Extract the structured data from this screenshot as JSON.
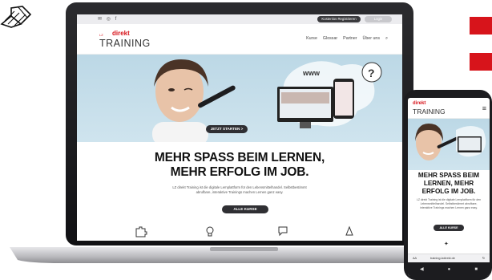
{
  "laptop_site": {
    "social_icons": [
      "mail-icon",
      "instagram-icon",
      "facebook-icon"
    ],
    "register_label": "Kostenlos Registrieren",
    "login_label": "Login",
    "brand": {
      "prefix": "LZ",
      "name": "direkt",
      "product": "TRAINING"
    },
    "nav": [
      "Kurse",
      "Glossar",
      "Partner",
      "Über uns"
    ],
    "hero_button": "JETZT STARTEN >",
    "headline": [
      "MEHR SPASS BEIM LERNEN,",
      "MEHR ERFOLG IM JOB."
    ],
    "intro": "LZ direkt Training ist die digitale Lernplattform für den Lebensmittelhandel. Selbstbestimmt abrufbare, interaktive Trainings machen Lernen ganz easy.",
    "courses_button": "ALLE KURSE"
  },
  "phone_site": {
    "brand_name": "direkt",
    "brand_product": "TRAINING",
    "headline": [
      "MEHR SPASS BEIM",
      "LERNEN, MEHR",
      "ERFOLG IM JOB."
    ],
    "intro": "LZ direkt Training ist die digitale Lernplattform für den Lebensmittelhandel. Selbstbestimmt abrufbare, interaktive Trainings machen Lernen ganz easy.",
    "courses_button": "ALLE KURSE",
    "url_left": "AA",
    "url": "training.lzdirekt.de"
  },
  "colors": {
    "brand_red": "#d7141b",
    "dark_button": "#2f2f33",
    "hero_blue": "#bcd8e6"
  }
}
